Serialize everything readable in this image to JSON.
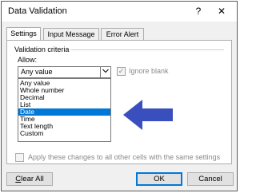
{
  "window": {
    "title": "Data Validation",
    "help_glyph": "?",
    "close_glyph": "✕"
  },
  "tabs": [
    {
      "label": "Settings",
      "active": true
    },
    {
      "label": "Input Message",
      "active": false
    },
    {
      "label": "Error Alert",
      "active": false
    }
  ],
  "settings": {
    "group_label": "Validation criteria",
    "allow_label": "Allow:",
    "allow_value": "Any value",
    "ignore_blank": {
      "label": "Ignore blank",
      "checked": true,
      "enabled": false
    },
    "dropdown_options": [
      {
        "label": "Any value",
        "selected": false
      },
      {
        "label": "Whole number",
        "selected": false
      },
      {
        "label": "Decimal",
        "selected": false
      },
      {
        "label": "List",
        "selected": false
      },
      {
        "label": "Date",
        "selected": true
      },
      {
        "label": "Time",
        "selected": false
      },
      {
        "label": "Text length",
        "selected": false
      },
      {
        "label": "Custom",
        "selected": false
      }
    ],
    "apply_all": {
      "label": "Apply these changes to all other cells with the same settings",
      "checked": false,
      "enabled": false
    }
  },
  "annotation": {
    "arrow_color": "#3a4fbe"
  },
  "buttons": {
    "clear_all_prefix": "C",
    "clear_all_rest": "lear All",
    "ok": "OK",
    "cancel": "Cancel"
  },
  "colors": {
    "selection": "#0078d7",
    "dialog_bg": "#f0f0f0"
  }
}
